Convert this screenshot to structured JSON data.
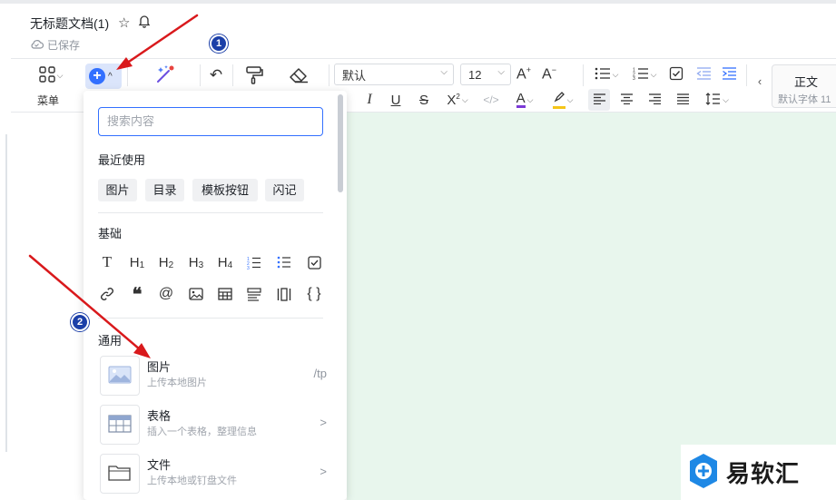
{
  "header": {
    "doc_title": "无标题文档(1)",
    "saved_status": "已保存"
  },
  "toolbar": {
    "menu_label": "菜单",
    "font_family": "默认",
    "font_size": "12",
    "style_name": "正文",
    "style_sub": "默认字体 11"
  },
  "panel": {
    "search_placeholder": "搜索内容",
    "recent_title": "最近使用",
    "recent_items": [
      "图片",
      "目录",
      "模板按钮",
      "闪记"
    ],
    "basic_title": "基础",
    "basic_row1": [
      "T",
      "H1",
      "H2",
      "H3",
      "H4"
    ],
    "general_title": "通用",
    "cards": [
      {
        "title": "图片",
        "sub": "上传本地图片",
        "right": "/tp"
      },
      {
        "title": "表格",
        "sub": "插入一个表格，整理信息",
        "right": ">"
      },
      {
        "title": "文件",
        "sub": "上传本地或钉盘文件",
        "right": ">"
      }
    ]
  },
  "annotations": {
    "badge1": "1",
    "badge2": "2"
  },
  "watermark": {
    "text": "易软汇"
  },
  "colors": {
    "accent": "#3370ff",
    "canvas": "#e8f6ed",
    "arrow": "#d9191c",
    "badge": "#1b3fa8"
  }
}
